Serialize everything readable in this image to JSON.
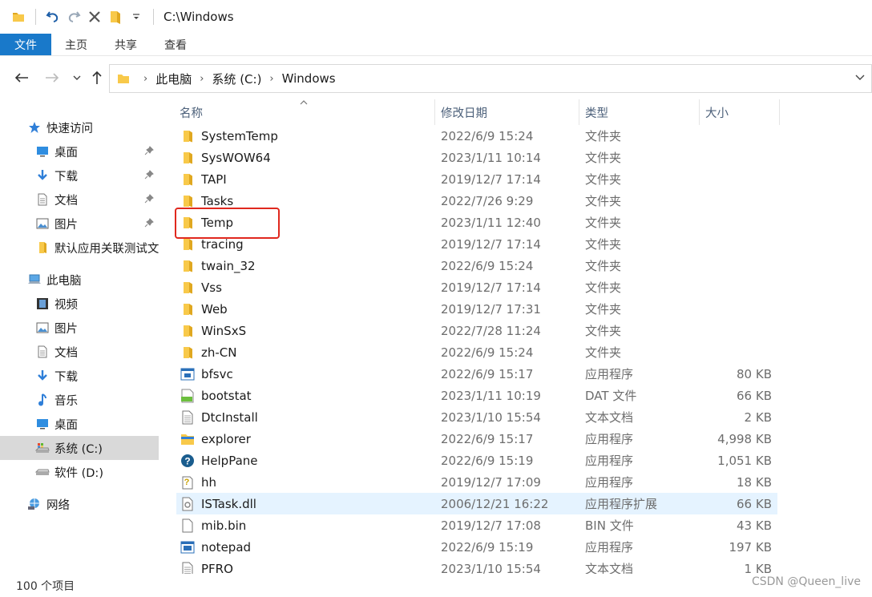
{
  "window": {
    "title": "C:\\Windows"
  },
  "ribbon": {
    "tabs": [
      "文件",
      "主页",
      "共享",
      "查看"
    ]
  },
  "address": {
    "crumbs": [
      "此电脑",
      "系统 (C:)",
      "Windows"
    ]
  },
  "sidebar": {
    "items": [
      {
        "label": "快速访问",
        "icon": "star-icon"
      },
      {
        "label": "桌面",
        "icon": "desktop-icon"
      },
      {
        "label": "下载",
        "icon": "download-icon"
      },
      {
        "label": "文档",
        "icon": "document-icon"
      },
      {
        "label": "图片",
        "icon": "pictures-icon"
      },
      {
        "label": "默认应用关联测试文",
        "icon": "folder-icon"
      },
      {
        "label": "此电脑",
        "icon": "computer-icon"
      },
      {
        "label": "视频",
        "icon": "video-icon"
      },
      {
        "label": "图片",
        "icon": "pictures-icon"
      },
      {
        "label": "文档",
        "icon": "document-icon"
      },
      {
        "label": "下载",
        "icon": "download-icon"
      },
      {
        "label": "音乐",
        "icon": "music-icon"
      },
      {
        "label": "桌面",
        "icon": "desktop-icon"
      },
      {
        "label": "系统 (C:)",
        "icon": "drive-c-icon"
      },
      {
        "label": "软件 (D:)",
        "icon": "drive-icon"
      },
      {
        "label": "网络",
        "icon": "network-icon"
      }
    ]
  },
  "columns": {
    "name": "名称",
    "date": "修改日期",
    "type": "类型",
    "size": "大小"
  },
  "files": [
    {
      "name": "SystemTemp",
      "date": "2022/6/9 15:24",
      "type": "文件夹",
      "size": "",
      "icon": "folder-icon"
    },
    {
      "name": "SysWOW64",
      "date": "2023/1/11 10:14",
      "type": "文件夹",
      "size": "",
      "icon": "folder-icon"
    },
    {
      "name": "TAPI",
      "date": "2019/12/7 17:14",
      "type": "文件夹",
      "size": "",
      "icon": "folder-icon"
    },
    {
      "name": "Tasks",
      "date": "2022/7/26 9:29",
      "type": "文件夹",
      "size": "",
      "icon": "folder-icon"
    },
    {
      "name": "Temp",
      "date": "2023/1/11 12:40",
      "type": "文件夹",
      "size": "",
      "icon": "folder-icon"
    },
    {
      "name": "tracing",
      "date": "2019/12/7 17:14",
      "type": "文件夹",
      "size": "",
      "icon": "folder-icon"
    },
    {
      "name": "twain_32",
      "date": "2022/6/9 15:24",
      "type": "文件夹",
      "size": "",
      "icon": "folder-icon"
    },
    {
      "name": "Vss",
      "date": "2019/12/7 17:14",
      "type": "文件夹",
      "size": "",
      "icon": "folder-icon"
    },
    {
      "name": "Web",
      "date": "2019/12/7 17:31",
      "type": "文件夹",
      "size": "",
      "icon": "folder-icon"
    },
    {
      "name": "WinSxS",
      "date": "2022/7/28 11:24",
      "type": "文件夹",
      "size": "",
      "icon": "folder-icon"
    },
    {
      "name": "zh-CN",
      "date": "2022/6/9 15:24",
      "type": "文件夹",
      "size": "",
      "icon": "folder-icon"
    },
    {
      "name": "bfsvc",
      "date": "2022/6/9 15:17",
      "type": "应用程序",
      "size": "80 KB",
      "icon": "app-icon"
    },
    {
      "name": "bootstat",
      "date": "2023/1/11 10:19",
      "type": "DAT 文件",
      "size": "66 KB",
      "icon": "dat-file-icon"
    },
    {
      "name": "DtcInstall",
      "date": "2023/1/10 15:54",
      "type": "文本文档",
      "size": "2 KB",
      "icon": "text-file-icon"
    },
    {
      "name": "explorer",
      "date": "2022/6/9 15:17",
      "type": "应用程序",
      "size": "4,998 KB",
      "icon": "explorer-icon"
    },
    {
      "name": "HelpPane",
      "date": "2022/6/9 15:19",
      "type": "应用程序",
      "size": "1,051 KB",
      "icon": "help-icon"
    },
    {
      "name": "hh",
      "date": "2019/12/7 17:09",
      "type": "应用程序",
      "size": "18 KB",
      "icon": "hh-help-icon"
    },
    {
      "name": "ISTask.dll",
      "date": "2006/12/21 16:22",
      "type": "应用程序扩展",
      "size": "66 KB",
      "icon": "dll-icon"
    },
    {
      "name": "mib.bin",
      "date": "2019/12/7 17:08",
      "type": "BIN 文件",
      "size": "43 KB",
      "icon": "blank-file-icon"
    },
    {
      "name": "notepad",
      "date": "2022/6/9 15:19",
      "type": "应用程序",
      "size": "197 KB",
      "icon": "notepad-icon"
    },
    {
      "name": "PFRO",
      "date": "2023/1/10 15:54",
      "type": "文本文档",
      "size": "1 KB",
      "icon": "text-file-icon"
    }
  ],
  "status": {
    "item_count": "100 个项目"
  },
  "watermark": "CSDN @Queen_live",
  "colors": {
    "file_tab": "#1979ca",
    "folder": "#f8c94a",
    "selected_row": "#e5f3ff",
    "highlight": "#e0281e"
  }
}
